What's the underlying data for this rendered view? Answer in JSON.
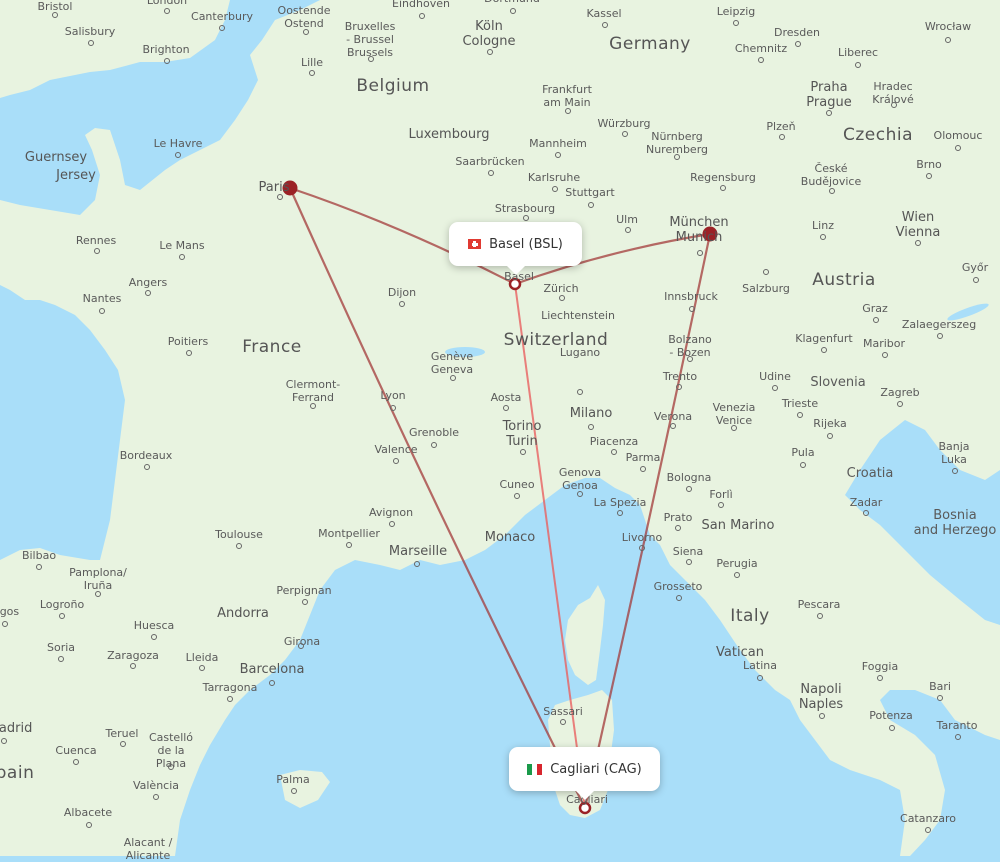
{
  "map": {
    "colors": {
      "sea": "#a9def9",
      "land": "#e8f3e0",
      "route_primary": "#a33a3a",
      "route_secondary": "#e87070",
      "hub_marker": "#9b2226"
    },
    "origin_popup": {
      "label": "Basel (BSL)",
      "flag": "switzerland-flag"
    },
    "destination_popup": {
      "label": "Cagliari (CAG)",
      "flag": "italy-flag"
    },
    "routes": [
      {
        "from": "Paris",
        "to": "Basel (BSL)",
        "style": "connecting"
      },
      {
        "from": "Paris",
        "to": "Cagliari (CAG)",
        "style": "connecting"
      },
      {
        "from": "Basel (BSL)",
        "to": "München",
        "style": "connecting"
      },
      {
        "from": "München",
        "to": "Cagliari (CAG)",
        "style": "connecting"
      },
      {
        "from": "Basel (BSL)",
        "to": "Cagliari (CAG)",
        "style": "direct"
      }
    ],
    "hubs": [
      "Paris",
      "München"
    ],
    "countries": [
      "Belgium",
      "Germany",
      "Czechia",
      "France",
      "Switzerland",
      "Austria",
      "Slovenia",
      "Croatia",
      "Italy",
      "Bosnia\nand Herzego",
      "Liechtenstein",
      "Luxembourg",
      "Monaco",
      "San Marino",
      "Andorra",
      "Vatican",
      "pain"
    ],
    "cities": [
      "Bristol",
      "London",
      "Canterbury",
      "Oostende\nOstend",
      "Eindhoven",
      "Dortmund",
      "Kassel",
      "Leipzig",
      "Dresden",
      "Wrocław",
      "Salisbury",
      "Brighton",
      "Bruxelles\n- Brussel\nBrussels",
      "Köln\nCologne",
      "Chemnitz",
      "Liberec",
      "Lille",
      "Frankfurt\nam Main",
      "Praha\nPrague",
      "Hradec\nKrálové",
      "Guernsey",
      "Jersey",
      "Le Havre",
      "Würzburg",
      "Nürnberg\nNuremberg",
      "Plzeň",
      "Olomouc",
      "Mannheim",
      "Saarbrücken",
      "Karlsruhe",
      "Stuttgart",
      "Regensburg",
      "České\nBudějovice",
      "Brno",
      "Paris",
      "Strasbourg",
      "Ulm",
      "München\nMunich",
      "Wien\nVienna",
      "Linz",
      "Rennes",
      "Le Mans",
      "Basel",
      "Zürich",
      "Salzburg",
      "Angers",
      "Nantes",
      "Dijon",
      "Innsbruck",
      "Graz",
      "Győr",
      "Poitiers",
      "Bolzano\n- Bozen",
      "Klagenfurt",
      "Maribor",
      "Zalaegerszeg",
      "Genève\nGeneva",
      "Lugano",
      "Trento",
      "Udine",
      "Clermont-\nFerrand",
      "Lyon",
      "Aosta",
      "Milano",
      "Trieste",
      "Venezia\nVenice",
      "Zagreb",
      "Grenoble",
      "Torino\nTurin",
      "Piacenza",
      "Verona",
      "Rijeka",
      "Bordeaux",
      "Valence",
      "Parma",
      "Bologna",
      "Pula",
      "Banja\nLuka",
      "Genova\nGenoa",
      "Cuneo",
      "Forlì",
      "Avignon",
      "La Spezia",
      "Prato",
      "Zadar",
      "Toulouse",
      "Montpellier",
      "Marseille",
      "Livorno",
      "Siena",
      "Perugia",
      "Bilbao",
      "Pamplona/\nIruña",
      "Grosseto",
      "Perpignan",
      "Logroño",
      "Pescara",
      "Huesca",
      "Girona",
      "Soria",
      "Zaragoza",
      "Lleida",
      "Barcelona",
      "Foggia",
      "Latina",
      "Tarragona",
      "Bari",
      "Napoli\nNaples",
      "Potenza",
      "Taranto",
      "Sassari",
      "Teruel",
      "Castelló\nde la\nPlana",
      "Cuenca",
      "Palma",
      "València",
      "Albacete",
      "Cagliari",
      "Catanzaro",
      "Alacant /\nAlicante",
      "Madrid",
      "Burgos"
    ],
    "attribution": ""
  }
}
